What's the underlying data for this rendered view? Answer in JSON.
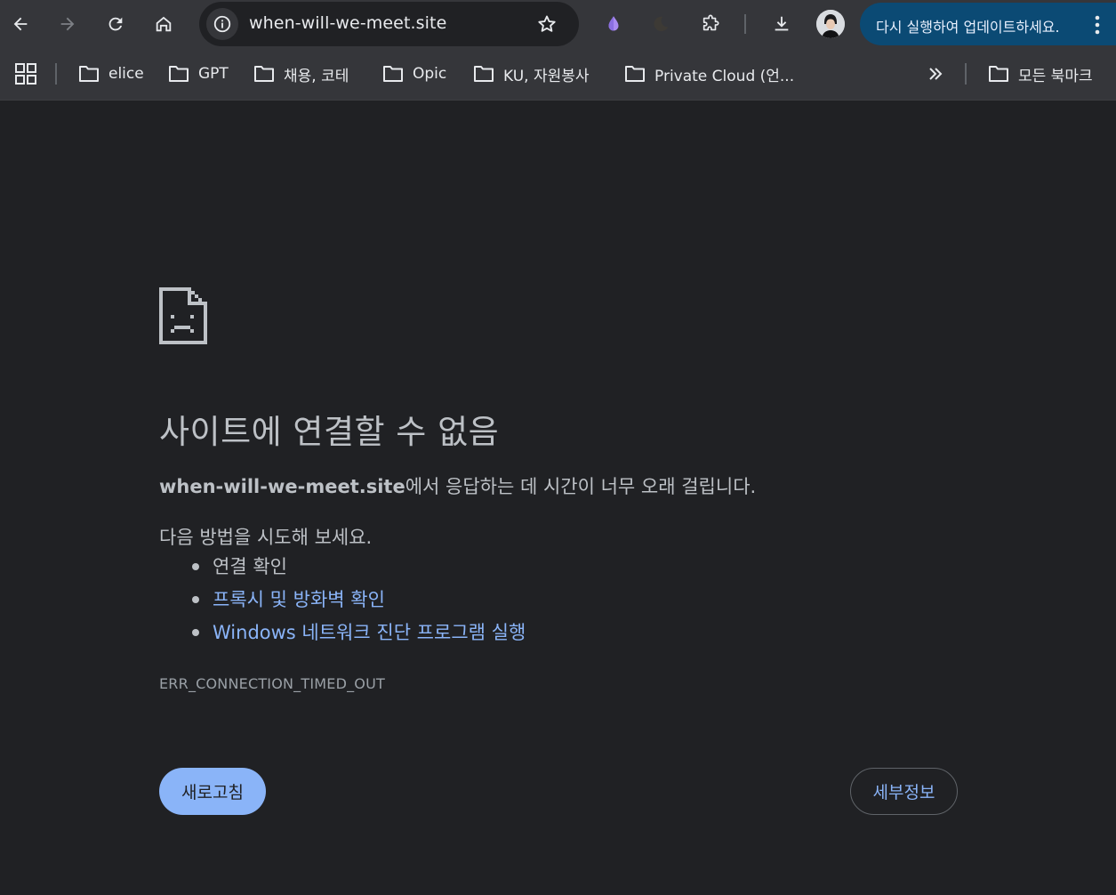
{
  "toolbar": {
    "url": "when-will-we-meet.site",
    "update_label": "다시 실행하여 업데이트하세요."
  },
  "bookmarks": [
    {
      "label": "elice"
    },
    {
      "label": "GPT"
    },
    {
      "label": "채용, 코테"
    },
    {
      "label": "Opic"
    },
    {
      "label": "KU, 자원봉사"
    },
    {
      "label": "Private Cloud (언..."
    }
  ],
  "all_bookmarks_label": "모든 북마크",
  "error": {
    "title": "사이트에 연결할 수 없음",
    "host": "when-will-we-meet.site",
    "desc_suffix": "에서 응답하는 데 시간이 너무 오래 걸립니다.",
    "suggest_heading": "다음 방법을 시도해 보세요.",
    "suggestions": [
      {
        "label": "연결 확인"
      },
      {
        "label": "프록시 및 방화벽 확인"
      },
      {
        "label": "Windows 네트워크 진단 프로그램 실행"
      }
    ],
    "code": "ERR_CONNECTION_TIMED_OUT",
    "reload_label": "새로고침",
    "details_label": "세부정보"
  },
  "colors": {
    "page_bg": "#202124",
    "toolbar_bg": "#35363a",
    "link": "#8ab4f8",
    "update_pill": "#0b4a74"
  }
}
